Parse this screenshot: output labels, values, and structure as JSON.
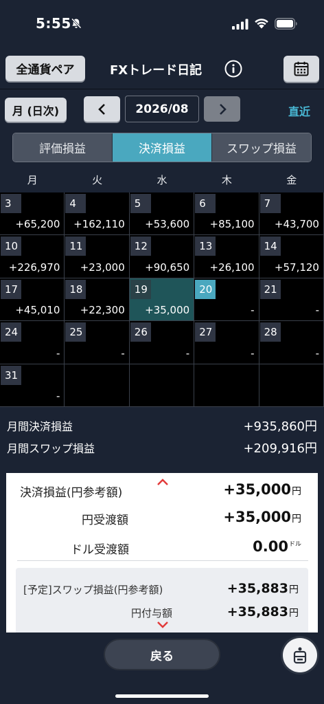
{
  "status_bar": {
    "time": "5:55"
  },
  "header": {
    "pair_button": "全通貨ペア",
    "title": "FXトレード日記"
  },
  "nav": {
    "mode_button": "月 (日次)",
    "period": "2026/08",
    "recent_link": "直近"
  },
  "tabs": [
    {
      "label": "評価損益",
      "active": false
    },
    {
      "label": "決済損益",
      "active": true
    },
    {
      "label": "スワップ損益",
      "active": false
    }
  ],
  "calendar": {
    "weekdays": [
      "月",
      "火",
      "水",
      "木",
      "金"
    ],
    "weeks": [
      [
        {
          "day": "3",
          "value": "+65,200"
        },
        {
          "day": "4",
          "value": "+162,110"
        },
        {
          "day": "5",
          "value": "+53,600"
        },
        {
          "day": "6",
          "value": "+85,100"
        },
        {
          "day": "7",
          "value": "+43,700"
        }
      ],
      [
        {
          "day": "10",
          "value": "+226,970"
        },
        {
          "day": "11",
          "value": "+23,000"
        },
        {
          "day": "12",
          "value": "+90,650"
        },
        {
          "day": "13",
          "value": "+26,100"
        },
        {
          "day": "14",
          "value": "+57,120"
        }
      ],
      [
        {
          "day": "17",
          "value": "+45,010"
        },
        {
          "day": "18",
          "value": "+22,300"
        },
        {
          "day": "19",
          "value": "+35,000",
          "selected": true
        },
        {
          "day": "20",
          "value": "-",
          "today": true
        },
        {
          "day": "21",
          "value": "-"
        }
      ],
      [
        {
          "day": "24",
          "value": "-"
        },
        {
          "day": "25",
          "value": "-"
        },
        {
          "day": "26",
          "value": "-"
        },
        {
          "day": "27",
          "value": "-"
        },
        {
          "day": "28",
          "value": "-"
        }
      ],
      [
        {
          "day": "31",
          "value": "-"
        },
        {
          "day": "",
          "value": ""
        },
        {
          "day": "",
          "value": ""
        },
        {
          "day": "",
          "value": ""
        },
        {
          "day": "",
          "value": ""
        }
      ]
    ]
  },
  "summary": {
    "settled_label": "月間決済損益",
    "settled_value": "+935,860円",
    "swap_label": "月間スワップ損益",
    "swap_value": "+209,916円"
  },
  "detail": {
    "settled_ref_label": "決済損益(円参考額)",
    "settled_ref_value": "+35,000",
    "yen_delivery_label": "円受渡額",
    "yen_delivery_value": "+35,000",
    "dollar_delivery_label": "ドル受渡額",
    "dollar_delivery_value": "0.00",
    "unit_yen": "円",
    "unit_dollar": "ドル",
    "swap_ref_label": "[予定]スワップ損益(円参考額)",
    "swap_ref_value": "+35,883",
    "yen_grant_label": "円付与額",
    "yen_grant_value": "+35,883"
  },
  "footer": {
    "back_button": "戻る"
  },
  "colors": {
    "accent": "#4aa8bf",
    "link": "#49b9d6",
    "caret": "#e23b3b",
    "background": "#1b2333"
  }
}
